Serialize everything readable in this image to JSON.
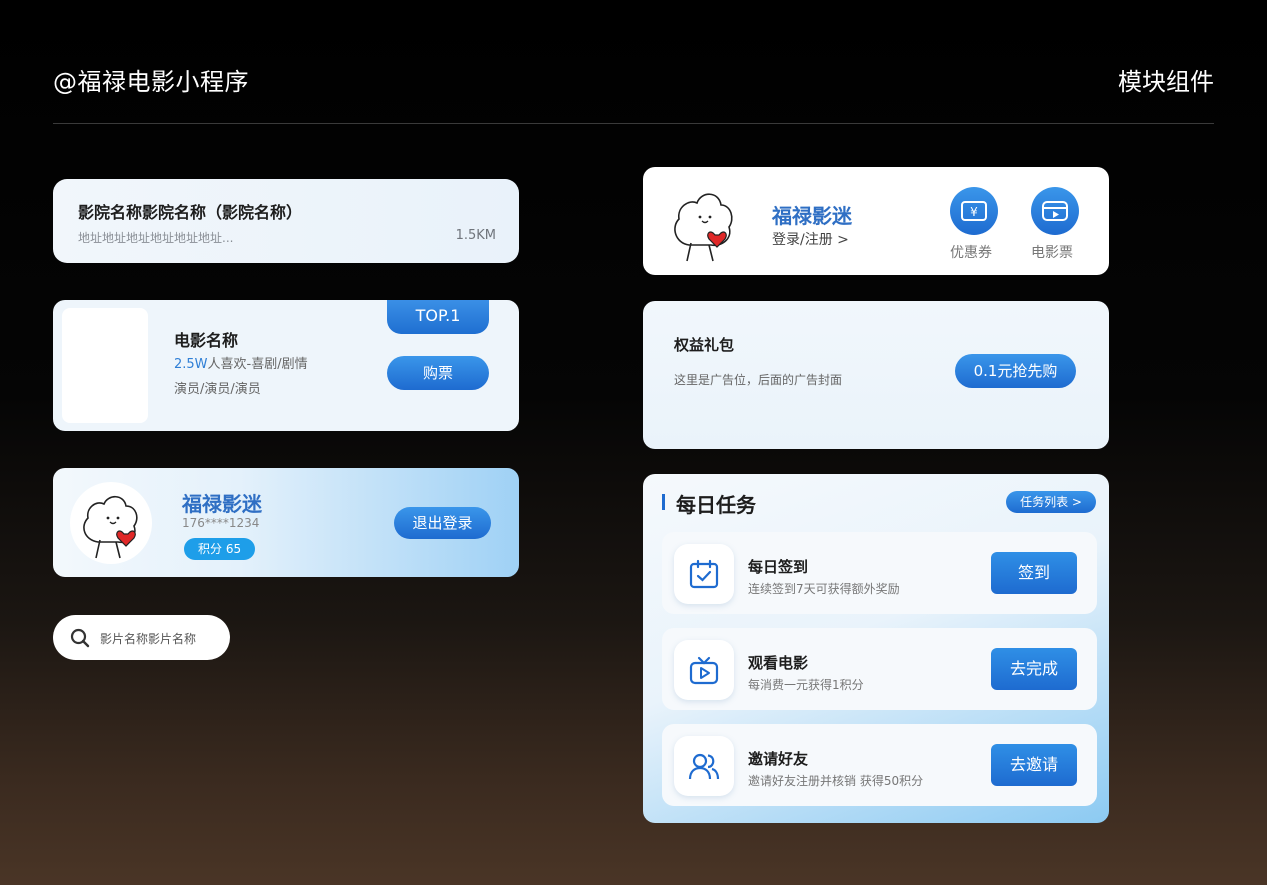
{
  "header": {
    "left_title": "@福禄电影小程序",
    "right_title": "模块组件"
  },
  "cinema": {
    "name": "影院名称影院名称（影院名称）",
    "address": "地址地址地址地址地址地址...",
    "distance": "1.5KM"
  },
  "movie": {
    "title": "电影名称",
    "likes_value": "2.5W",
    "likes_text": "人喜欢-喜剧/剧情",
    "cast": "演员/演员/演员",
    "badge": "TOP.1",
    "buy_label": "购票"
  },
  "user": {
    "name": "福禄影迷",
    "phone": "176****1234",
    "points": "积分  65",
    "logout_label": "退出登录"
  },
  "search": {
    "placeholder": "影片名称影片名称",
    "icon": "search-icon"
  },
  "member": {
    "name": "福禄影迷",
    "login": "登录/注册 >",
    "actions": [
      {
        "label": "优惠券",
        "icon": "coupon-icon"
      },
      {
        "label": "电影票",
        "icon": "ticket-icon"
      }
    ]
  },
  "gift": {
    "title": "权益礼包",
    "desc": "这里是广告位，后面的广告封面",
    "button": "0.1元抢先购"
  },
  "tasks": {
    "title": "每日任务",
    "list_label": "任务列表 >",
    "items": [
      {
        "name": "每日签到",
        "desc": "连续签到7天可获得额外奖励",
        "button": "签到",
        "icon": "calendar-check-icon"
      },
      {
        "name": "观看电影",
        "desc": "每消费一元获得1积分",
        "button": "去完成",
        "icon": "tv-play-icon"
      },
      {
        "name": "邀请好友",
        "desc": "邀请好友注册并核销 获得50积分",
        "button": "去邀请",
        "icon": "friends-icon"
      }
    ]
  },
  "colors": {
    "accent": "#1e6bd0",
    "accent_light": "#3a96ea",
    "name_blue": "#2f6fc4"
  }
}
